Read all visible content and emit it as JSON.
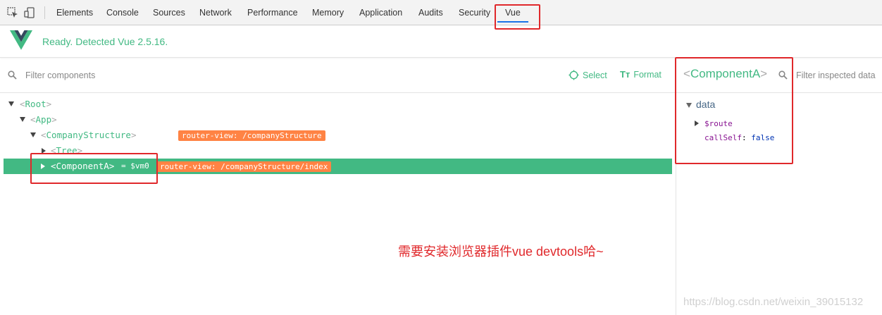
{
  "devtools": {
    "tabs": [
      "Elements",
      "Console",
      "Sources",
      "Network",
      "Performance",
      "Memory",
      "Application",
      "Audits",
      "Security",
      "Vue"
    ],
    "active_tab": "Vue"
  },
  "vue_header": {
    "message": "Ready. Detected Vue 2.5.16."
  },
  "toolbar": {
    "filter_placeholder": "Filter components",
    "select_label": "Select",
    "format_icon": "Tт",
    "format_label": "Format"
  },
  "tree": {
    "root": "Root",
    "app": "App",
    "company": "CompanyStructure",
    "company_badge": "router-view: /companyStructure",
    "tree_node": "Tree",
    "selected": "<ComponentA>",
    "selected_ref": "= $vm0",
    "selected_badge": "router-view: /companyStructure/index"
  },
  "inspector": {
    "component_name": "ComponentA",
    "filter_placeholder": "Filter inspected data",
    "section": "data",
    "props": [
      {
        "key": "$route",
        "value": ""
      },
      {
        "key": "callSelf",
        "value": "false"
      }
    ]
  },
  "annotation_text": "需要安装浏览器插件vue devtools哈~",
  "watermark": "https://blog.csdn.net/weixin_39015132",
  "colors": {
    "vue_green": "#42b983",
    "badge_orange": "#ff8344",
    "annotation_red": "#e0282b"
  }
}
